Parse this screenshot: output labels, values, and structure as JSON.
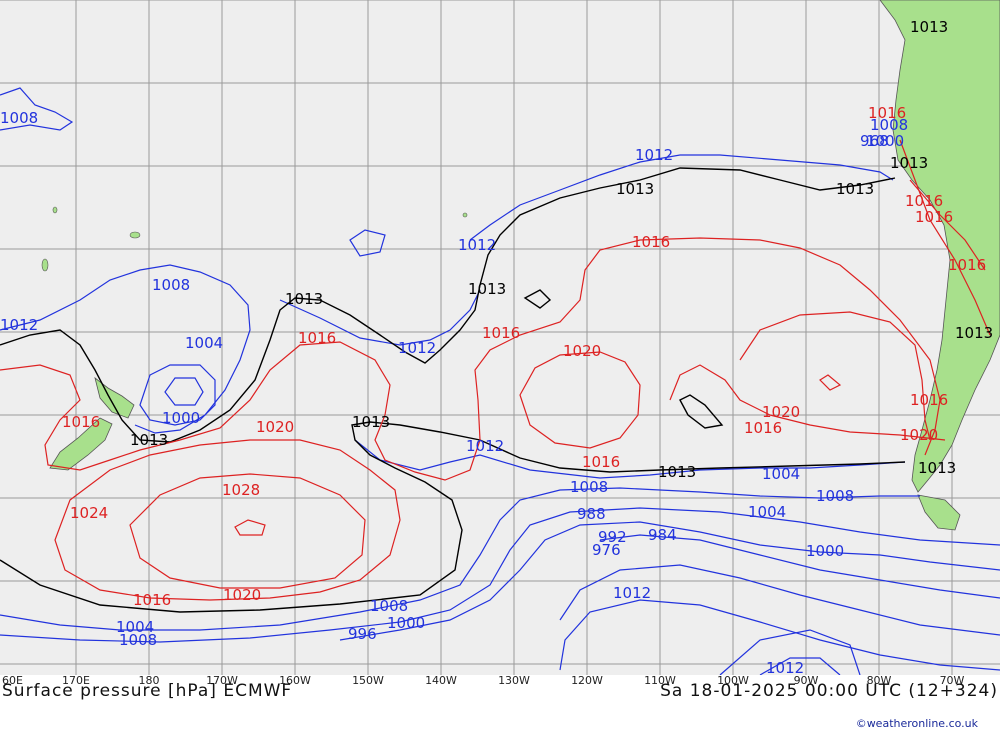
{
  "map": {
    "title_left": "Surface pressure [hPa] ECMWF",
    "title_right": "Sa 18-01-2025 00:00 UTC (12+324)",
    "credit": "©weatheronline.co.uk",
    "colors": {
      "ocean": "#eeeeee",
      "land": "#a8e08c",
      "grid": "#9a9a9a",
      "low": "#2233dd",
      "reference": "#000000",
      "high": "#dd2222"
    },
    "longitude_labels": [
      "60E",
      "170E",
      "180",
      "170W",
      "160W",
      "150W",
      "140W",
      "130W",
      "120W",
      "110W",
      "100W",
      "90W",
      "80W",
      "70W"
    ],
    "isobar_labels": {
      "blue": [
        "1008",
        "1012",
        "1012",
        "1012",
        "1012",
        "1012",
        "1008",
        "1004",
        "1000",
        "1008",
        "1008",
        "1004",
        "1000",
        "1008",
        "1004",
        "1000",
        "996",
        "988",
        "992",
        "984",
        "976",
        "1012",
        "1004",
        "1008",
        "1000",
        "968",
        "1012",
        "1008"
      ],
      "black": [
        "1013",
        "1013",
        "1013",
        "1013",
        "1013",
        "1013",
        "1013",
        "1013",
        "1013",
        "1013",
        "1013"
      ],
      "red": [
        "1016",
        "1016",
        "1016",
        "1016",
        "1020",
        "1020",
        "1024",
        "1028",
        "1020",
        "1016",
        "1016",
        "1020",
        "1016",
        "1020",
        "1016",
        "1016",
        "1016",
        "1016",
        "1016"
      ]
    }
  }
}
